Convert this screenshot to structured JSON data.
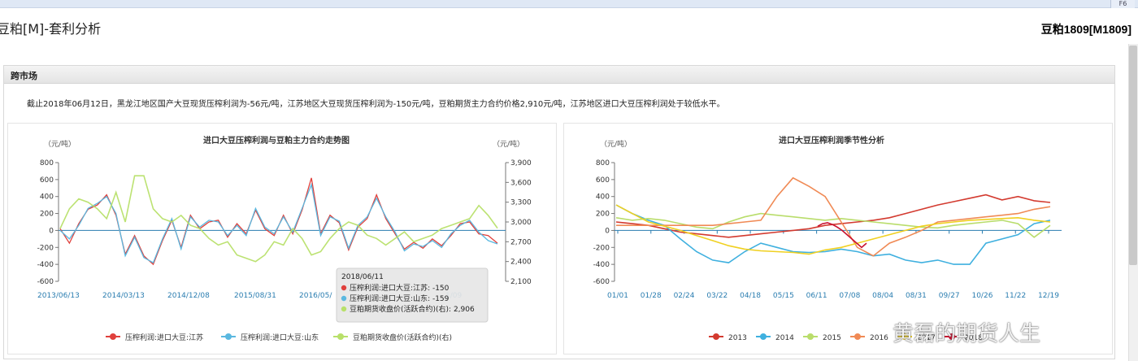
{
  "window": {
    "f6_label": "F6"
  },
  "header": {
    "title": "豆粕[M]-套利分析",
    "contract": "豆粕1809[M1809]"
  },
  "panel": {
    "title": "跨市场",
    "summary": "截止2018年06月12日，黑龙江地区国产大豆现货压榨利润为-56元/吨，江苏地区大豆现货压榨利润为-150元/吨，豆粕期货主力合约价格2,910元/吨，江苏地区进口大豆压榨利润处于较低水平。"
  },
  "watermark": "黄磊的期货人生",
  "colors": {
    "jiangsu": "#e0403c",
    "shandong": "#5ab8e0",
    "futures": "#b8e06a",
    "y2013": "#d33a2f",
    "y2014": "#3fb0df",
    "y2015": "#b9dd6b",
    "y2016": "#f08a55",
    "y2017": "#f0d020",
    "y2018": "#c8102e"
  },
  "chart_data": [
    {
      "type": "line",
      "title": "进口大豆压榨利润与豆粕主力合约走势图",
      "ylabel_left": "（元/吨）",
      "ylabel_right": "（元/吨）",
      "ylim": [
        -600,
        800
      ],
      "y_ticks": [
        "800",
        "600",
        "400",
        "200",
        "0",
        "-200",
        "-400",
        "-600"
      ],
      "ylim_right": [
        2100,
        3900
      ],
      "y_ticks_right": [
        "3,900",
        "3,600",
        "3,300",
        "3,000",
        "2,700",
        "2,400",
        "2,100"
      ],
      "x_ticks": [
        "2013/06/13",
        "2014/03/13",
        "2014/12/08",
        "2015/08/31",
        "2016/05/",
        "1/09"
      ],
      "series": [
        {
          "name": "压榨利润:进口大豆:江苏",
          "values": [
            20,
            -150,
            80,
            250,
            300,
            420,
            180,
            -280,
            -60,
            -300,
            -400,
            -120,
            120,
            -200,
            180,
            20,
            100,
            120,
            -80,
            80,
            -40,
            240,
            20,
            -60,
            180,
            -40,
            240,
            620,
            -40,
            180,
            90,
            -230,
            40,
            140,
            420,
            140,
            -40,
            -220,
            -140,
            -210,
            -100,
            -180,
            -60,
            80,
            100,
            -40,
            -60,
            -150
          ]
        },
        {
          "name": "压榨利润:进口大豆:山东",
          "values": [
            0,
            -100,
            60,
            260,
            320,
            400,
            200,
            -300,
            -80,
            -320,
            -380,
            -100,
            140,
            -220,
            160,
            40,
            120,
            100,
            -60,
            60,
            -60,
            260,
            40,
            -40,
            160,
            -20,
            260,
            540,
            -60,
            160,
            110,
            -210,
            60,
            160,
            380,
            160,
            -20,
            -240,
            -160,
            -190,
            -120,
            -200,
            -40,
            60,
            120,
            -20,
            -120,
            -159
          ]
        },
        {
          "name": "豆粕期货收盘价(活跃合约)(右)",
          "values": [
            2900,
            3200,
            3350,
            3300,
            3200,
            3050,
            3450,
            3000,
            3700,
            3700,
            3200,
            3050,
            3000,
            3100,
            2950,
            2900,
            2750,
            2650,
            2700,
            2500,
            2450,
            2400,
            2500,
            2700,
            2650,
            2900,
            2750,
            2500,
            2550,
            2750,
            2900,
            3000,
            2950,
            2800,
            2750,
            2650,
            2750,
            2850,
            2700,
            2750,
            2800,
            2900,
            2950,
            3000,
            3050,
            3250,
            3100,
            2906
          ]
        }
      ],
      "tooltip": {
        "date": "2018/06/11",
        "lines": [
          "压榨利润:进口大豆:江苏: -150",
          "压榨利润:进口大豆:山东: -159",
          "豆粕期货收盘价(活跃合约)(右): 2,906"
        ]
      },
      "legend": [
        "压榨利润:进口大豆:江苏",
        "压榨利润:进口大豆:山东",
        "豆粕期货收盘价(活跃合约)(右)"
      ]
    },
    {
      "type": "line",
      "title": "进口大豆压榨利润季节性分析",
      "ylabel": "（元/吨）",
      "ylim": [
        -600,
        800
      ],
      "y_ticks": [
        "800",
        "600",
        "400",
        "200",
        "0",
        "-200",
        "-400",
        "-600"
      ],
      "x_ticks": [
        "01/01",
        "01/28",
        "02/24",
        "03/22",
        "04/18",
        "05/15",
        "06/11",
        "07/08",
        "08/04",
        "08/31",
        "09/27",
        "10/26",
        "11/22",
        "12/19"
      ],
      "series": [
        {
          "name": "2013",
          "values": [
            100,
            80,
            60,
            20,
            -20,
            -40,
            -60,
            -80,
            -60,
            -40,
            -20,
            0,
            20,
            60,
            80,
            100,
            120,
            150,
            200,
            250,
            300,
            340,
            380,
            420,
            360,
            400,
            350,
            330
          ]
        },
        {
          "name": "2014",
          "values": [
            300,
            200,
            120,
            60,
            -100,
            -250,
            -350,
            -380,
            -250,
            -150,
            -200,
            -250,
            -260,
            -250,
            -220,
            -250,
            -300,
            -280,
            -350,
            -380,
            -350,
            -400,
            -400,
            -150,
            -100,
            -50,
            80,
            120
          ]
        },
        {
          "name": "2015",
          "values": [
            150,
            120,
            140,
            120,
            80,
            40,
            20,
            100,
            160,
            200,
            180,
            160,
            140,
            120,
            140,
            120,
            100,
            80,
            60,
            40,
            30,
            60,
            80,
            100,
            120,
            80,
            -80,
            60
          ]
        },
        {
          "name": "2016",
          "values": [
            60,
            60,
            60,
            60,
            60,
            60,
            60,
            80,
            100,
            120,
            400,
            620,
            520,
            400,
            100,
            -200,
            -300,
            -150,
            -80,
            0,
            100,
            120,
            140,
            160,
            180,
            200,
            250,
            280
          ]
        },
        {
          "name": "2017",
          "values": [
            300,
            200,
            100,
            50,
            0,
            -60,
            -120,
            -180,
            -220,
            -240,
            -250,
            -260,
            -280,
            -230,
            -200,
            -150,
            -100,
            -50,
            0,
            50,
            80,
            100,
            120,
            130,
            140,
            150,
            120,
            100
          ]
        },
        {
          "name": "2018",
          "values": [
            50,
            80,
            90,
            70,
            40,
            0,
            -50,
            -100,
            -150,
            -200,
            -150
          ]
        }
      ],
      "legend": [
        "2013",
        "2014",
        "2015",
        "2016",
        "2017",
        "2018"
      ]
    }
  ]
}
